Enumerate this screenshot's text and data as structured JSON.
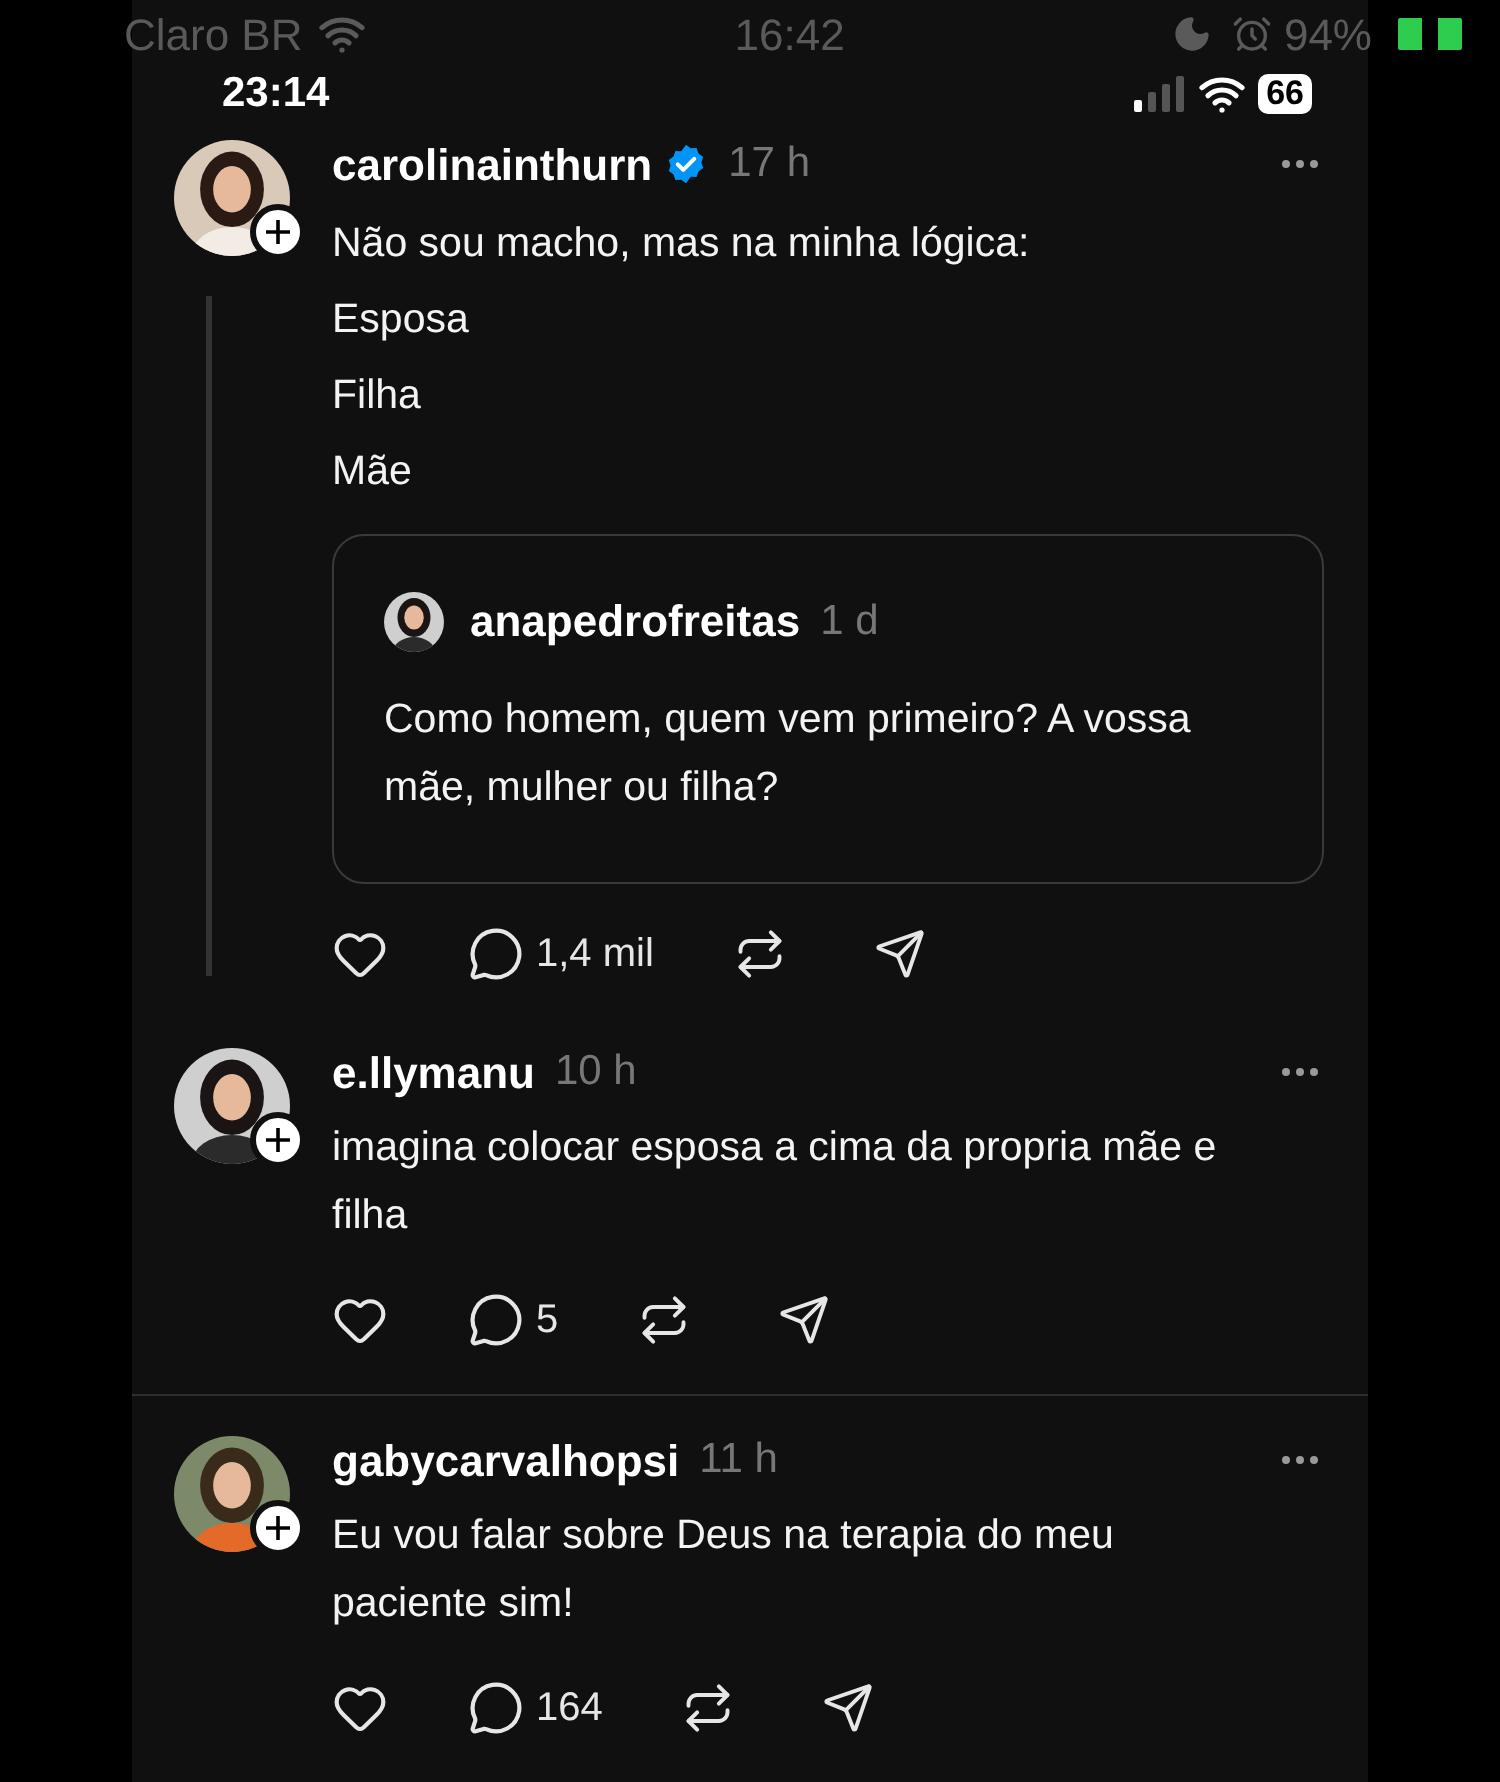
{
  "ghost_status_bar": {
    "carrier": "Claro BR",
    "time": "16:42",
    "battery": "94%"
  },
  "status_bar": {
    "time": "23:14",
    "battery": "66"
  },
  "posts": [
    {
      "username": "carolinainthurn",
      "verified": true,
      "time": "17 h",
      "thread_line": true,
      "lines": [
        "Não sou macho, mas na minha lógica:",
        "Esposa",
        "Filha",
        "Mãe"
      ],
      "quote": {
        "username": "anapedrofreitas",
        "time": "1 d",
        "text": "Como homem, quem vem primeiro? A vossa mãe, mulher ou filha?"
      },
      "replies": "1,4 mil"
    },
    {
      "username": "e.llymanu",
      "verified": false,
      "time": "10 h",
      "thread_line": false,
      "lines": [
        "imagina colocar esposa a cima da propria mãe e filha"
      ],
      "replies": "5"
    },
    {
      "username": "gabycarvalhopsi",
      "verified": false,
      "time": "11 h",
      "thread_line": false,
      "lines": [
        "Eu vou falar sobre Deus na terapia do meu paciente sim!"
      ],
      "replies": "164"
    }
  ]
}
